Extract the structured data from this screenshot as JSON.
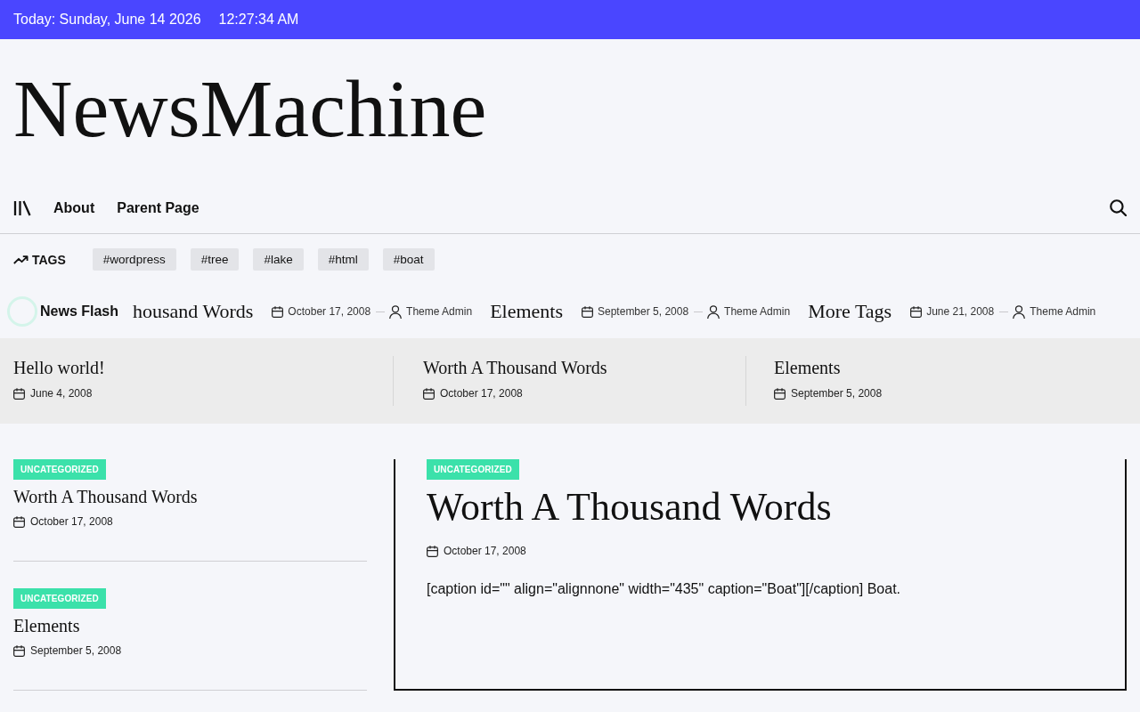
{
  "top_bar": {
    "date": "Today: Sunday, June 14 2026",
    "time": "12:27:34 AM"
  },
  "site_title": "NewsMachine",
  "nav": {
    "items": [
      {
        "label": "About"
      },
      {
        "label": "Parent Page"
      }
    ]
  },
  "tags": {
    "heading": "TAGS",
    "items": [
      "#wordpress",
      "#tree",
      "#lake",
      "#html",
      "#boat"
    ]
  },
  "news_flash": {
    "label": "News Flash",
    "items": [
      {
        "title": "housand Words",
        "date": "October 17, 2008",
        "author": "Theme Admin"
      },
      {
        "title": "Elements",
        "date": "September 5, 2008",
        "author": "Theme Admin"
      },
      {
        "title": "More Tags",
        "date": "June 21, 2008",
        "author": "Theme Admin"
      }
    ]
  },
  "featured": [
    {
      "title": "Hello world!",
      "date": "June 4, 2008"
    },
    {
      "title": "Worth A Thousand Words",
      "date": "October 17, 2008"
    },
    {
      "title": "Elements",
      "date": "September 5, 2008"
    }
  ],
  "sidebar_posts": [
    {
      "category": "UNCATEGORIZED",
      "title": "Worth A Thousand Words",
      "date": "October 17, 2008"
    },
    {
      "category": "UNCATEGORIZED",
      "title": "Elements",
      "date": "September 5, 2008"
    }
  ],
  "article": {
    "category": "UNCATEGORIZED",
    "title": "Worth A Thousand Words",
    "date": "October 17, 2008",
    "excerpt": "[caption id=\"\" align=\"alignnone\" width=\"435\" caption=\"Boat\"][/caption] Boat."
  }
}
